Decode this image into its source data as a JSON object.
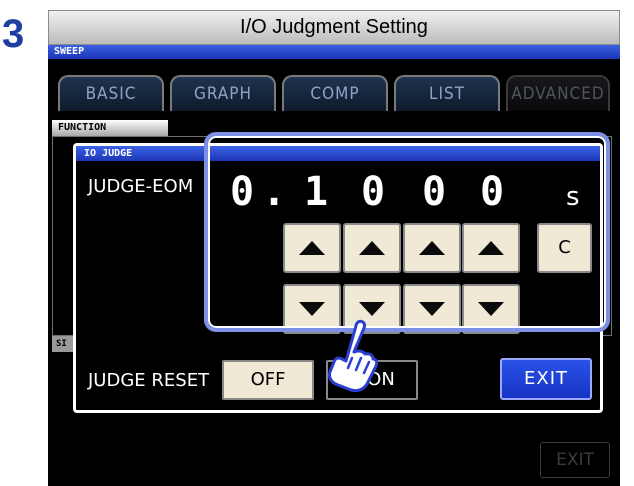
{
  "step_number": "3",
  "window": {
    "title": "I/O Judgment Setting"
  },
  "screen": {
    "mode_label": "SWEEP",
    "tabs": [
      {
        "label": "BASIC",
        "enabled": true
      },
      {
        "label": "GRAPH",
        "enabled": true
      },
      {
        "label": "COMP",
        "enabled": true
      },
      {
        "label": "LIST",
        "enabled": true
      },
      {
        "label": "ADVANCED",
        "enabled": false
      }
    ],
    "function_label": "FUNCTION",
    "section_label": "SI",
    "background_exit_label": "EXIT"
  },
  "dialog": {
    "title": "IO JUDGE",
    "judge_eom_label": "JUDGE-EOM",
    "value_digits": [
      "0",
      ".",
      "1",
      "0",
      "0",
      "0"
    ],
    "unit": "s",
    "clear_label": "C",
    "judge_reset_label": "JUDGE RESET",
    "off_label": "OFF",
    "on_label": "ON",
    "exit_label": "EXIT"
  },
  "icons": {
    "up_arrow": "triangle-up",
    "down_arrow": "triangle-down",
    "cursor": "pointing-hand"
  },
  "colors": {
    "accent_blue": "#1d36b6",
    "highlight_frame": "#7e8fe8",
    "button_face": "#efe9d6",
    "step_number": "#1e3fa0"
  }
}
